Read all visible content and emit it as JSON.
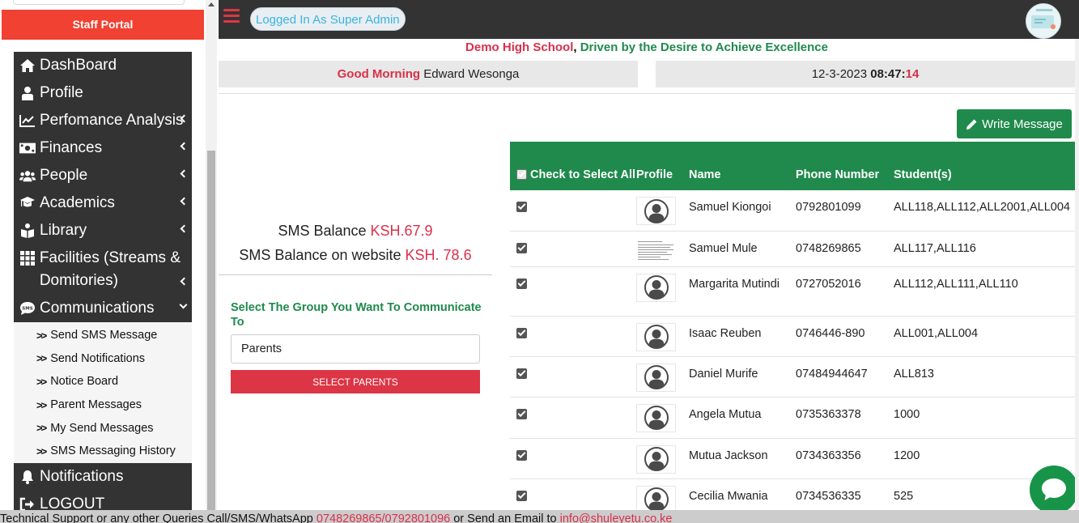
{
  "sidebar": {
    "portal_title": "Staff Portal",
    "menu": [
      {
        "label": "DashBoard",
        "icon": "home-icon"
      },
      {
        "label": "Profile",
        "icon": "user-icon"
      },
      {
        "label": "Perfomance Analysis",
        "icon": "chart-line-icon"
      },
      {
        "label": "Finances",
        "icon": "money-bill-icon"
      },
      {
        "label": "People",
        "icon": "users-icon"
      },
      {
        "label": "Academics",
        "icon": "graduation-cap-icon"
      },
      {
        "label": "Library",
        "icon": "book-reader-icon"
      },
      {
        "label": "Facilities (Streams & Domitories)",
        "icon": "grid-icon"
      },
      {
        "label": "Communications",
        "icon": "sms-icon"
      }
    ],
    "submenu": [
      {
        "label": "Send SMS Message"
      },
      {
        "label": "Send Notifications"
      },
      {
        "label": "Notice Board"
      },
      {
        "label": "Parent Messages"
      },
      {
        "label": "My Send Messages"
      },
      {
        "label": "SMS Messaging History"
      }
    ],
    "bottom": [
      {
        "label": "Notifications",
        "icon": "bell-icon"
      },
      {
        "label": "LOGOUT",
        "icon": "sign-out-icon"
      }
    ]
  },
  "topbar": {
    "logged_in": "Logged In As Super Admin"
  },
  "header": {
    "school_name": "Demo High School",
    "comma": ",",
    "motto": "Driven by the Desire to Achieve Excellence",
    "greeting": "Good Morning",
    "user_name": "Edward Wesonga",
    "date": "12-3-2023",
    "time_hm": "08:47:",
    "time_s": "14"
  },
  "sms": {
    "balance_label": "SMS Balance",
    "balance_value": "KSH.67.9",
    "website_label": "SMS Balance on website",
    "website_value": "KSH. 78.6",
    "group_prompt": "Select The Group You Want To Communicate To",
    "group_value": "Parents",
    "select_button": "SELECT PARENTS"
  },
  "actions": {
    "write_message": "Write Message"
  },
  "table": {
    "headers": {
      "check": "Check to Select All",
      "profile": "Profile",
      "name": "Name",
      "phone": "Phone Number",
      "students": "Student(s)"
    },
    "rows": [
      {
        "name": "Samuel Kiongoi",
        "phone": "0792801099",
        "students": "ALL118,ALL112,ALL2001,ALL004",
        "profile": "avatar"
      },
      {
        "name": "Samuel Mule",
        "phone": "0748269865",
        "students": "ALL117,ALL116",
        "profile": "document"
      },
      {
        "name": "Margarita Mutindi",
        "phone": "0727052016",
        "students": "ALL112,ALL111,ALL110",
        "profile": "avatar"
      },
      {
        "name": "Isaac Reuben",
        "phone": "0746446-890",
        "students": "ALL001,ALL004",
        "profile": "avatar"
      },
      {
        "name": "Daniel Murife",
        "phone": "07484944647",
        "students": "ALL813",
        "profile": "avatar"
      },
      {
        "name": "Angela Mutua",
        "phone": "0735363378",
        "students": "1000",
        "profile": "avatar"
      },
      {
        "name": "Mutua Jackson",
        "phone": "0734363356",
        "students": "1200",
        "profile": "avatar"
      },
      {
        "name": "Cecilia Mwania",
        "phone": "0734536335",
        "students": "525",
        "profile": "avatar"
      }
    ]
  },
  "footer": {
    "text1": "Technical Support or any other Queries Call/SMS/WhatsApp ",
    "phones": "0748269865/0792801096",
    "text2": " or Send an Email to ",
    "email": "info@shuleyetu.co.ke"
  },
  "colors": {
    "brand_green": "#1f8a4c",
    "accent_red": "#dc3545",
    "sidebar_dark": "#333333"
  }
}
